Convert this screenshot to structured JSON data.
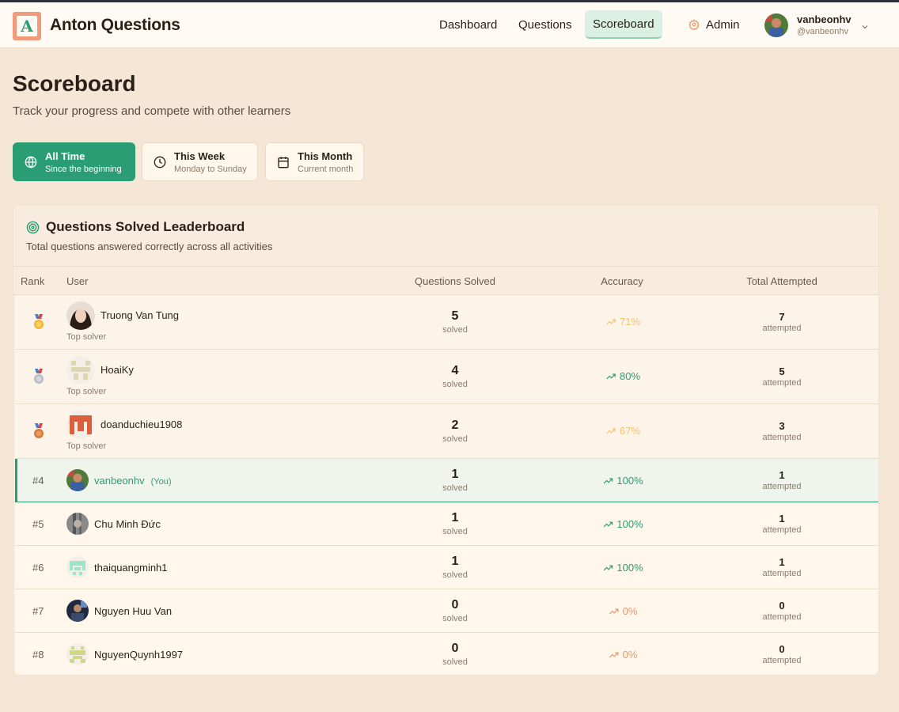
{
  "brand": {
    "name": "Anton Questions",
    "logo_letter": "A"
  },
  "nav": {
    "dashboard": "Dashboard",
    "questions": "Questions",
    "scoreboard": "Scoreboard",
    "admin": "Admin"
  },
  "user": {
    "name": "vanbeonhv",
    "handle": "@vanbeonhv"
  },
  "page": {
    "title": "Scoreboard",
    "subtitle": "Track your progress and compete with other learners"
  },
  "filters": [
    {
      "title": "All Time",
      "sub": "Since the beginning",
      "active": true,
      "icon": "globe-icon"
    },
    {
      "title": "This Week",
      "sub": "Monday to Sunday",
      "active": false,
      "icon": "clock-icon"
    },
    {
      "title": "This Month",
      "sub": "Current month",
      "active": false,
      "icon": "calendar-icon"
    }
  ],
  "leaderboard": {
    "title": "Questions Solved Leaderboard",
    "description": "Total questions answered correctly across all activities",
    "icon": "target-icon",
    "columns": {
      "rank": "Rank",
      "user": "User",
      "solved": "Questions Solved",
      "accuracy": "Accuracy",
      "attempted": "Total Attempted"
    },
    "solved_unit": "solved",
    "attempted_unit": "attempted",
    "top_label": "Top solver",
    "you_label": "(You)",
    "rows": [
      {
        "rank": "1",
        "medal": "gold",
        "name": "Truong Van Tung",
        "solved": "5",
        "accuracy": "71%",
        "attempted": "7"
      },
      {
        "rank": "2",
        "medal": "silver",
        "name": "HoaiKy",
        "solved": "4",
        "accuracy": "80%",
        "attempted": "5"
      },
      {
        "rank": "3",
        "medal": "bronze",
        "name": "doanduchieu1908",
        "solved": "2",
        "accuracy": "67%",
        "attempted": "3"
      },
      {
        "rank": "#4",
        "name": "vanbeonhv",
        "solved": "1",
        "accuracy": "100%",
        "attempted": "1",
        "is_me": true
      },
      {
        "rank": "#5",
        "name": "Chu Minh Đức",
        "solved": "1",
        "accuracy": "100%",
        "attempted": "1"
      },
      {
        "rank": "#6",
        "name": "thaiquangminh1",
        "solved": "1",
        "accuracy": "100%",
        "attempted": "1"
      },
      {
        "rank": "#7",
        "name": "Nguyen Huu Van",
        "solved": "0",
        "accuracy": "0%",
        "attempted": "0"
      },
      {
        "rank": "#8",
        "name": "NguyenQuynh1997",
        "solved": "0",
        "accuracy": "0%",
        "attempted": "0"
      }
    ]
  },
  "colors": {
    "accent": "#2a9d74",
    "accuracy_high": "#2a9d74",
    "accuracy_mid": "#f5c16c",
    "accuracy_low": "#e6966a",
    "gold": "#f2b632",
    "silver": "#b9bcc4",
    "bronze": "#d97a38"
  }
}
